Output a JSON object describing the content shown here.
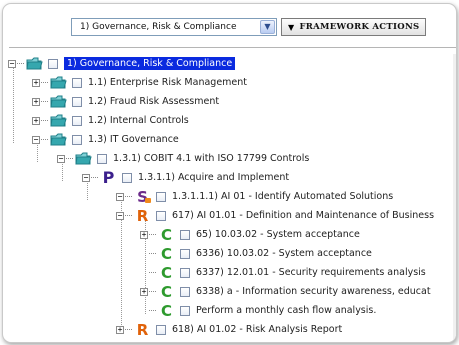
{
  "toolbar": {
    "framework_select_value": "1) Governance, Risk & Compliance",
    "framework_actions_label": "FRAMEWORK ACTIONS"
  },
  "colors": {
    "selection": "#0a2adf",
    "folder": "#2a9aa0",
    "letter_p": "#3b1f8c",
    "letter_s": "#6b2a8a",
    "letter_r": "#e0620a",
    "letter_c": "#2e9a2e"
  },
  "tree": {
    "items": [
      {
        "label": "1) Governance, Risk & Compliance",
        "icon": "folder-icon",
        "expander": "−"
      },
      {
        "label": "1.1) Enterprise Risk Management",
        "icon": "folder-icon",
        "expander": "+"
      },
      {
        "label": "1.2) Fraud Risk Assessment",
        "icon": "folder-icon",
        "expander": "+"
      },
      {
        "label": "1.2) Internal Controls",
        "icon": "folder-icon",
        "expander": "+"
      },
      {
        "label": "1.3) IT Governance",
        "icon": "folder-icon",
        "expander": "−"
      },
      {
        "label": "1.3.1) COBIT 4.1 with ISO 17799 Controls",
        "icon": "folder-icon",
        "expander": "−"
      },
      {
        "label": "1.3.1.1) Acquire and Implement",
        "icon": "process-icon",
        "letter": "P",
        "expander": "−"
      },
      {
        "label": "1.3.1.1.1) AI 01 - Identify Automated Solutions",
        "icon": "subprocess-icon",
        "letter": "S",
        "expander": "−"
      },
      {
        "label": "617) AI 01.01 - Definition and Maintenance of Business",
        "icon": "risk-icon",
        "letter": "R",
        "expander": "−"
      },
      {
        "label": "65) 10.03.02 - System acceptance",
        "icon": "control-icon",
        "letter": "C",
        "expander": "+"
      },
      {
        "label": "6336) 10.03.02 - System acceptance",
        "icon": "control-icon",
        "letter": "C",
        "expander": ""
      },
      {
        "label": "6337) 12.01.01 - Security requirements analysis",
        "icon": "control-icon",
        "letter": "C",
        "expander": ""
      },
      {
        "label": "6338) a - Information security awareness, educat",
        "icon": "control-icon",
        "letter": "C",
        "expander": "+"
      },
      {
        "label": "Perform a monthly cash flow analysis.",
        "icon": "control-icon",
        "letter": "C",
        "expander": ""
      },
      {
        "label": "618) AI 01.02 - Risk Analysis Report",
        "icon": "risk-icon",
        "letter": "R",
        "expander": "+"
      }
    ]
  }
}
